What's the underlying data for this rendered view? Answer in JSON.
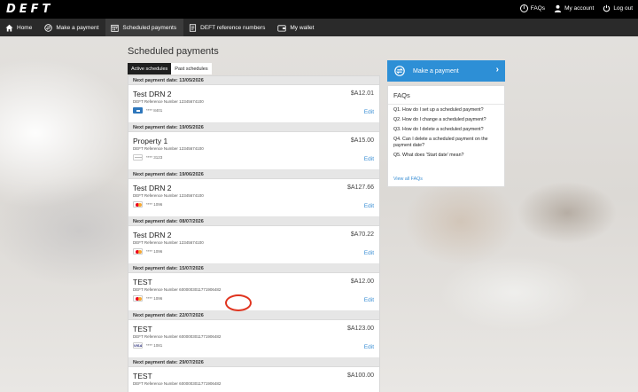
{
  "header": {
    "logo": "DEFT",
    "links": [
      {
        "icon": "info-icon",
        "label": "FAQs"
      },
      {
        "icon": "user-icon",
        "label": "My account"
      },
      {
        "icon": "power-icon",
        "label": "Log out"
      }
    ]
  },
  "nav": {
    "items": [
      {
        "icon": "home-icon",
        "label": "Home"
      },
      {
        "icon": "payment-icon",
        "label": "Make a payment"
      },
      {
        "icon": "calendar-icon",
        "label": "Scheduled payments"
      },
      {
        "icon": "document-icon",
        "label": "DEFT reference numbers"
      },
      {
        "icon": "wallet-icon",
        "label": "My wallet"
      }
    ],
    "active_index": 2
  },
  "main": {
    "title": "Scheduled payments",
    "tabs": [
      {
        "label": "Active schedules"
      },
      {
        "label": "Past schedules"
      }
    ],
    "edit_label": "Edit",
    "groups": [
      {
        "date": "Next payment date: 13/05/2026",
        "payment": {
          "name": "Test DRN 2",
          "amount": "$A12.01",
          "reference": "DEFT Reference Number 12345674100",
          "card_type": "amex",
          "card_number": "**** 8401"
        }
      },
      {
        "date": "Next payment date: 19/05/2026",
        "payment": {
          "name": "Property 1",
          "amount": "$A15.00",
          "reference": "DEFT Reference Number 12345674100",
          "card_type": "generic",
          "card_number": "**** 3123"
        }
      },
      {
        "date": "Next payment date: 19/06/2026",
        "payment": {
          "name": "Test DRN 2",
          "amount": "$A127.66",
          "reference": "DEFT Reference Number 12345674100",
          "card_type": "mastercard",
          "card_number": "**** 1096"
        }
      },
      {
        "date": "Next payment date: 08/07/2026",
        "payment": {
          "name": "Test DRN 2",
          "amount": "$A70.22",
          "reference": "DEFT Reference Number 12345674100",
          "card_type": "mastercard",
          "card_number": "**** 1096"
        }
      },
      {
        "date": "Next payment date: 15/07/2026",
        "payment": {
          "name": "TEST",
          "amount": "$A12.00",
          "reference": "DEFT Reference Number 6000003011771906482",
          "card_type": "mastercard",
          "card_number": "**** 1096"
        }
      },
      {
        "date": "Next payment date: 22/07/2026",
        "payment": {
          "name": "TEST",
          "amount": "$A123.00",
          "reference": "DEFT Reference Number 6000003011771906482",
          "card_type": "visa",
          "card_number": "**** 1081"
        }
      },
      {
        "date": "Next payment date: 29/07/2026",
        "payment": {
          "name": "TEST",
          "amount": "$A100.00",
          "reference": "DEFT Reference Number 6000003011771906482",
          "card_type": "mastercard",
          "card_number": ""
        }
      }
    ]
  },
  "sidebar": {
    "make_payment_label": "Make a payment",
    "faq_title": "FAQs",
    "faqs": [
      "Q1. How do I set up a scheduled payment?",
      "Q2. How do I change a scheduled payment?",
      "Q3. How do I delete a scheduled payment?",
      "Q4. Can I delete a scheduled payment on the payment date?",
      "Q5. What does 'Start date' mean?"
    ],
    "view_all_label": "View all FAQs"
  },
  "colors": {
    "accent_blue": "#2d8fd6",
    "link_blue": "#3b8fd4",
    "highlight_ring": "#e0341f",
    "topbar": "#000000",
    "navbar": "#2a2a2a"
  }
}
